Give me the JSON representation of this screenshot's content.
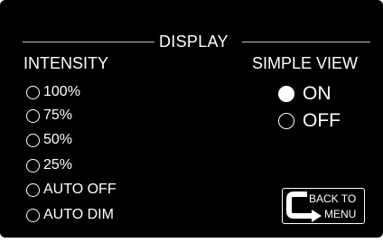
{
  "section": {
    "title": "DISPLAY"
  },
  "intensity": {
    "heading": "INTENSITY",
    "options": [
      {
        "label": "100%",
        "selected": false
      },
      {
        "label": "75%",
        "selected": false
      },
      {
        "label": "50%",
        "selected": false
      },
      {
        "label": "25%",
        "selected": false
      },
      {
        "label": "AUTO OFF",
        "selected": false
      },
      {
        "label": "AUTO DIM",
        "selected": false
      }
    ]
  },
  "simple_view": {
    "heading": "SIMPLE VIEW",
    "options": [
      {
        "label": "ON",
        "selected": true
      },
      {
        "label": "OFF",
        "selected": false
      }
    ]
  },
  "back_button": {
    "line1": "BACK TO",
    "line2": "MENU",
    "icon": "return-arrow-icon"
  },
  "colors": {
    "background": "#000000",
    "foreground": "#ffffff",
    "rule": "#bfbfbf"
  }
}
